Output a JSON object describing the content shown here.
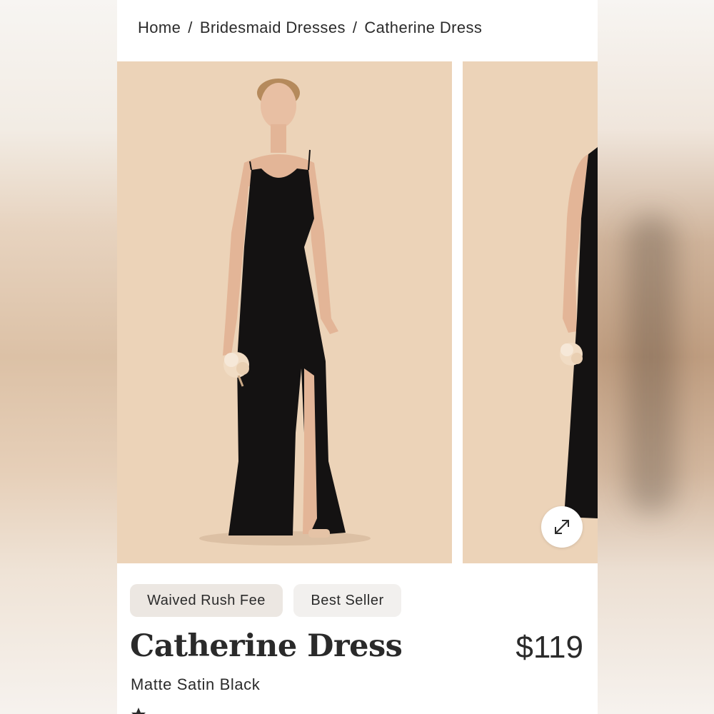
{
  "breadcrumb": {
    "items": [
      "Home",
      "Bridesmaid Dresses",
      "Catherine Dress"
    ],
    "separator": "/"
  },
  "gallery": {
    "main_image_alt": "Model wearing black Catherine Dress",
    "next_image_alt": "Side view of Catherine Dress",
    "expand_icon": "expand-arrows-icon"
  },
  "badges": {
    "rush": "Waived Rush Fee",
    "seller": "Best Seller"
  },
  "product": {
    "title": "Catherine Dress",
    "price": "$119",
    "variant": "Matte Satin Black"
  },
  "rating": {
    "star_icon": "star-icon"
  },
  "colors": {
    "backdrop": "#ecd3b8",
    "dress": "#141212",
    "badge_rush_bg": "#ece7e2",
    "badge_seller_bg": "#f2f0ee",
    "text": "#2b2b2b"
  }
}
